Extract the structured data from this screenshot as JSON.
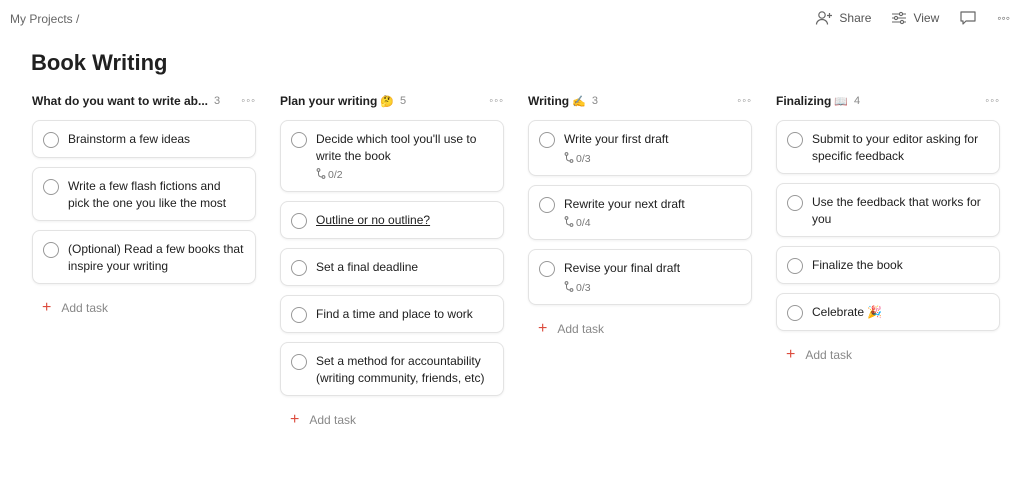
{
  "breadcrumb": "My Projects /",
  "header": {
    "share_label": "Share",
    "view_label": "View",
    "icons": [
      "add-person-icon",
      "sliders-icon",
      "comment-icon",
      "more-icon"
    ]
  },
  "page_title": "Book Writing",
  "more_glyph": "◦◦◦",
  "add_task_label": "Add task",
  "columns": [
    {
      "title": "What do you want to write ab...",
      "emoji": "",
      "count": "3",
      "tasks": [
        {
          "title": "Brainstorm a few ideas",
          "subtasks": ""
        },
        {
          "title": "Write a few flash fictions and pick the one you like the most",
          "subtasks": ""
        },
        {
          "title": "(Optional) Read a few books that inspire your writing",
          "subtasks": ""
        }
      ]
    },
    {
      "title": "Plan your writing",
      "emoji": "🤔",
      "count": "5",
      "tasks": [
        {
          "title": "Decide which tool you'll use to write the book",
          "subtasks": "0/2"
        },
        {
          "title": "Outline or no outline?",
          "subtasks": "",
          "link": true
        },
        {
          "title": "Set a final deadline",
          "subtasks": ""
        },
        {
          "title": "Find a time and place to work",
          "subtasks": ""
        },
        {
          "title": "Set a method for accountability (writing community, friends, etc)",
          "subtasks": ""
        }
      ]
    },
    {
      "title": "Writing",
      "emoji": "✍️",
      "count": "3",
      "tasks": [
        {
          "title": "Write your first draft",
          "subtasks": "0/3"
        },
        {
          "title": "Rewrite your next draft",
          "subtasks": "0/4"
        },
        {
          "title": "Revise your final draft",
          "subtasks": "0/3"
        }
      ]
    },
    {
      "title": "Finalizing",
      "emoji": "📖",
      "count": "4",
      "tasks": [
        {
          "title": "Submit to your editor asking for specific feedback",
          "subtasks": ""
        },
        {
          "title": "Use the feedback that works for you",
          "subtasks": ""
        },
        {
          "title": "Finalize the book",
          "subtasks": ""
        },
        {
          "title": "Celebrate",
          "emoji": "🎉",
          "subtasks": ""
        }
      ]
    }
  ]
}
